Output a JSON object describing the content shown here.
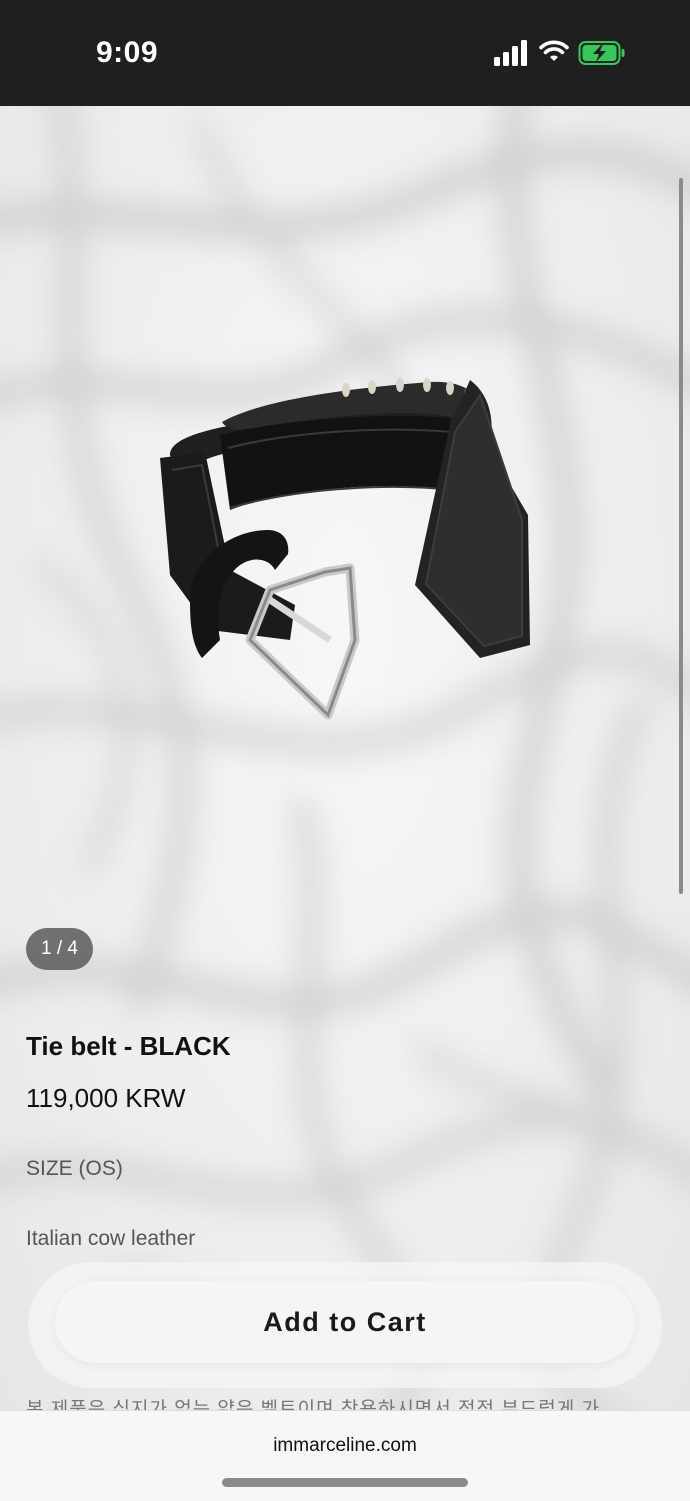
{
  "status_bar": {
    "time": "9:09"
  },
  "gallery": {
    "counter": "1 / 4"
  },
  "product": {
    "title": "Tie belt - BLACK",
    "price": "119,000 KRW",
    "size": "SIZE (OS)",
    "material": "Italian cow leather",
    "description": "본 제품은 심지가 없는 얇은 벨트이며 착용하시면서 점점 부드럽게 가"
  },
  "cart": {
    "button_label": "Add to Cart"
  },
  "browser": {
    "url": "immarceline.com"
  },
  "colors": {
    "status_bar_bg": "#1f1f1f",
    "battery_green": "#34c759"
  },
  "icons": [
    "cellular-signal-icon",
    "wifi-icon",
    "battery-charging-icon"
  ]
}
